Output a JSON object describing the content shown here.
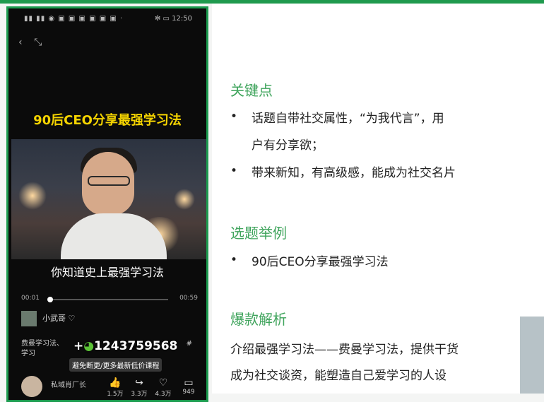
{
  "phone": {
    "status_left": "▮▮ ▮▮ ◉ ▣ ▣ ▣ ▣ ▣ ▣ ·",
    "status_right": "✻ ▭ 12:50",
    "headline": "90后CEO分享最强学习法",
    "subtitle": "你知道史上最强学习法",
    "time_current": "00:01",
    "time_total": "00:59",
    "progress_fraction": 0.02,
    "author": "小武哥 ♡",
    "description_line1": "费曼学习法、",
    "description_suffix": "#",
    "description_line2": "学习",
    "watermark_prefix": "+",
    "watermark_id": "1243759568",
    "tagline": "避免断更/更多最新低价课程",
    "account": "私域肖厂长",
    "actions": [
      {
        "icon": "like-icon",
        "glyph": "👍",
        "count": "1.5万"
      },
      {
        "icon": "share-icon",
        "glyph": "↪",
        "count": "3.3万"
      },
      {
        "icon": "heart-icon",
        "glyph": "♡",
        "count": "4.3万"
      },
      {
        "icon": "comment-icon",
        "glyph": "▭",
        "count": "949"
      }
    ]
  },
  "slide": {
    "section1_title": "关键点",
    "section1_items": [
      "话题自带社交属性，“为我代言”，用",
      "户有分享欲；",
      "带来新知，有高级感，能成为社交名片"
    ],
    "section2_title": "选题举例",
    "section2_items": [
      "90后CEO分享最强学习法"
    ],
    "section3_title": "爆款解析",
    "section3_lines": [
      "介绍最强学习法——费曼学习法，提供干货",
      "成为社交谈资，能塑造自己爱学习的人设"
    ]
  },
  "colors": {
    "accent": "#3fa45c",
    "frame": "#1c9b4f",
    "headline": "#f5d400"
  }
}
